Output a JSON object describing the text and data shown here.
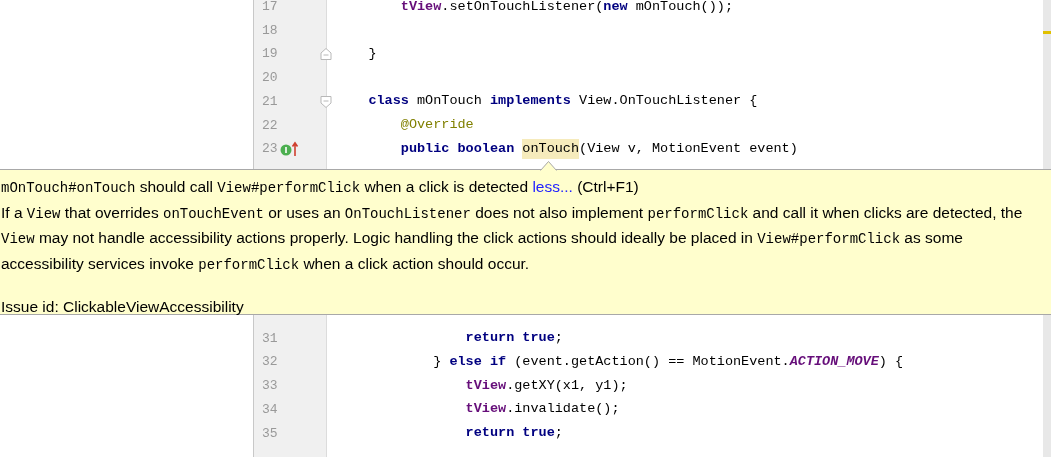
{
  "editor": {
    "lines_top": [
      {
        "number": "17",
        "tokens": [
          {
            "text": "        tView",
            "kind": "field"
          },
          {
            "text": ".setOnTouchListener(",
            "kind": "plain"
          },
          {
            "text": "new",
            "kind": "keyword"
          },
          {
            "text": " mOnTouch());",
            "kind": "plain"
          }
        ]
      },
      {
        "number": "18"
      },
      {
        "number": "19",
        "gutter_icon": {
          "kind": "fold_end"
        },
        "tokens": [
          {
            "text": "    }",
            "kind": "plain"
          }
        ]
      },
      {
        "number": "20"
      },
      {
        "number": "21",
        "gutter_icon": {
          "kind": "fold_start"
        },
        "tokens": [
          {
            "text": "    class",
            "kind": "keyword"
          },
          {
            "text": " mOnTouch ",
            "kind": "plain"
          },
          {
            "text": "implements",
            "kind": "keyword"
          },
          {
            "text": " View.OnTouchListener {",
            "kind": "plain"
          }
        ]
      },
      {
        "number": "22",
        "tokens": [
          {
            "text": "        @Override",
            "kind": "annotation"
          }
        ]
      },
      {
        "number": "23",
        "gutter_icon": {
          "kind": "implements"
        },
        "tokens": [
          {
            "text": "        public boolean ",
            "kind": "keyword"
          },
          {
            "text": "onTouch",
            "kind": "highlighted"
          },
          {
            "text": "(View v, MotionEvent event)",
            "kind": "plain"
          }
        ]
      }
    ],
    "lines_bottom": [
      {
        "number": "31",
        "tokens": [
          {
            "text": "                return true",
            "kind": "keyword"
          },
          {
            "text": ";",
            "kind": "plain"
          }
        ]
      },
      {
        "number": "32",
        "tokens": [
          {
            "text": "            } ",
            "kind": "plain"
          },
          {
            "text": "else if",
            "kind": "keyword"
          },
          {
            "text": " (event.getAction() == MotionEvent.",
            "kind": "plain"
          },
          {
            "text": "ACTION_MOVE",
            "kind": "constant"
          },
          {
            "text": ") {",
            "kind": "plain"
          }
        ]
      },
      {
        "number": "33",
        "tokens": [
          {
            "text": "                tView",
            "kind": "field"
          },
          {
            "text": ".getXY(x1, y1);",
            "kind": "plain"
          }
        ]
      },
      {
        "number": "34",
        "tokens": [
          {
            "text": "                tView",
            "kind": "field"
          },
          {
            "text": ".invalidate();",
            "kind": "plain"
          }
        ]
      },
      {
        "number": "35",
        "tokens": [
          {
            "text": "                return true",
            "kind": "keyword"
          },
          {
            "text": ";",
            "kind": "plain"
          }
        ]
      }
    ]
  },
  "tooltip": {
    "title": [
      {
        "text": "mOnTouch#onTouch",
        "code": true
      },
      {
        "text": " should call ",
        "code": false
      },
      {
        "text": "View#performClick",
        "code": true
      },
      {
        "text": " when a click is detected ",
        "code": false
      }
    ],
    "link": "less...",
    "shortcut": " (Ctrl+F1)",
    "description": [
      {
        "text": "If a ",
        "code": false
      },
      {
        "text": "View",
        "code": true
      },
      {
        "text": " that overrides ",
        "code": false
      },
      {
        "text": "onTouchEvent",
        "code": true
      },
      {
        "text": " or uses an ",
        "code": false
      },
      {
        "text": "OnTouchListener",
        "code": true
      },
      {
        "text": " does not also implement ",
        "code": false
      },
      {
        "text": "performClick",
        "code": true
      },
      {
        "text": " and call it when clicks are detected, the ",
        "code": false
      },
      {
        "text": "View",
        "code": true
      },
      {
        "text": " may not handle accessibility actions properly. Logic handling the click actions should ideally be placed in ",
        "code": false
      },
      {
        "text": "View#performClick",
        "code": true
      },
      {
        "text": " as some accessibility services invoke ",
        "code": false
      },
      {
        "text": "performClick",
        "code": true
      },
      {
        "text": " when a click action should occur.",
        "code": false
      }
    ],
    "issue_id": "Issue id: ClickableViewAccessibility"
  }
}
